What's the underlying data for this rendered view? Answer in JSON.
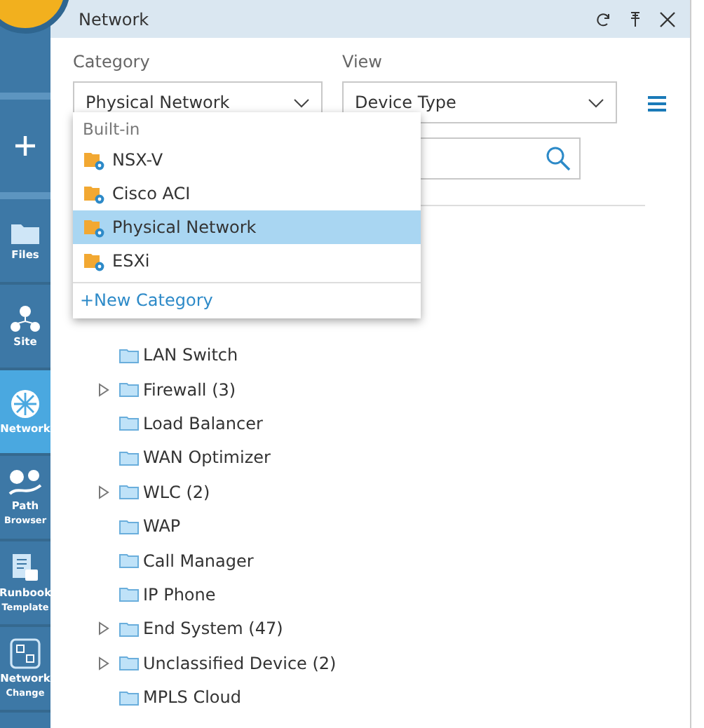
{
  "sidebar": {
    "items": [
      {
        "selected": false
      },
      {
        "lines": [
          "Files"
        ],
        "selected": false
      },
      {
        "lines": [
          "Site"
        ],
        "selected": false
      },
      {
        "lines": [
          "Network"
        ],
        "selected": true
      },
      {
        "lines": [
          "Path",
          "Browser"
        ],
        "selected": false
      },
      {
        "lines": [
          "Runbook",
          "Template"
        ],
        "selected": false
      },
      {
        "lines": [
          "Network",
          "Change"
        ],
        "selected": false
      }
    ]
  },
  "panel": {
    "title": "Network",
    "category": {
      "label": "Category",
      "value": "Physical Network"
    },
    "view": {
      "label": "View",
      "value": "Device Type"
    },
    "dropdown": {
      "group": "Built-in",
      "options": [
        {
          "label": "NSX-V",
          "selected": false
        },
        {
          "label": "Cisco ACI",
          "selected": false
        },
        {
          "label": "Physical Network",
          "selected": true
        },
        {
          "label": "ESXi",
          "selected": false
        }
      ],
      "action": "+New Category"
    },
    "tree": [
      {
        "label": "LAN Switch",
        "expandable": false
      },
      {
        "label": "Firewall (3)",
        "expandable": true
      },
      {
        "label": "Load Balancer",
        "expandable": false
      },
      {
        "label": "WAN Optimizer",
        "expandable": false
      },
      {
        "label": "WLC (2)",
        "expandable": true
      },
      {
        "label": "WAP",
        "expandable": false
      },
      {
        "label": "Call Manager",
        "expandable": false
      },
      {
        "label": "IP Phone",
        "expandable": false
      },
      {
        "label": "End System (47)",
        "expandable": true
      },
      {
        "label": "Unclassified Device (2)",
        "expandable": true
      },
      {
        "label": "MPLS Cloud",
        "expandable": false
      }
    ]
  }
}
